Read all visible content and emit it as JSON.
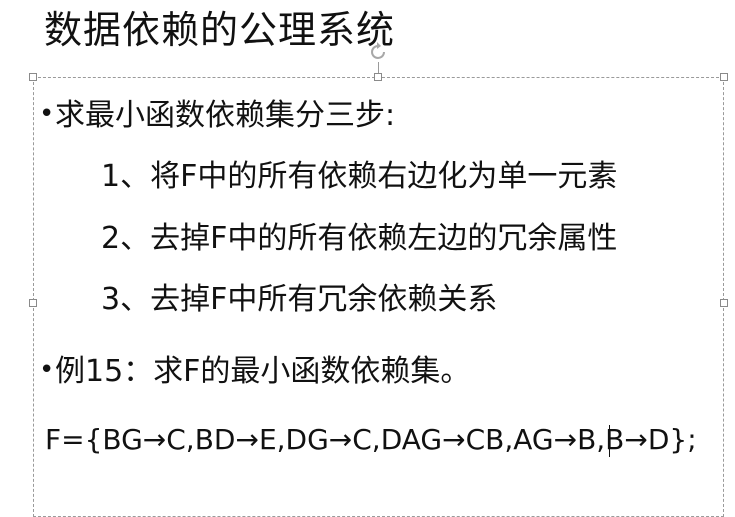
{
  "slide": {
    "title": "数据依赖的公理系统",
    "body": {
      "bullet_symbol": "•",
      "lines": [
        "求最小函数依赖集分三步:",
        "1、将F中的所有依赖右边化为单一元素",
        "2、去掉F中的所有依赖左边的冗余属性",
        "3、去掉F中所有冗余依赖关系",
        "例15：求F的最小函数依赖集。",
        "F={BG→C,BD→E,DG→C,DAG→CB,AG→B,B→D};"
      ]
    }
  },
  "colors": {
    "text": "#111111",
    "selection_border": "#9a9a9a",
    "handle_fill": "#ffffff"
  },
  "icons": {
    "rotate": "rotate-handle-icon",
    "resize": "resize-handle"
  }
}
